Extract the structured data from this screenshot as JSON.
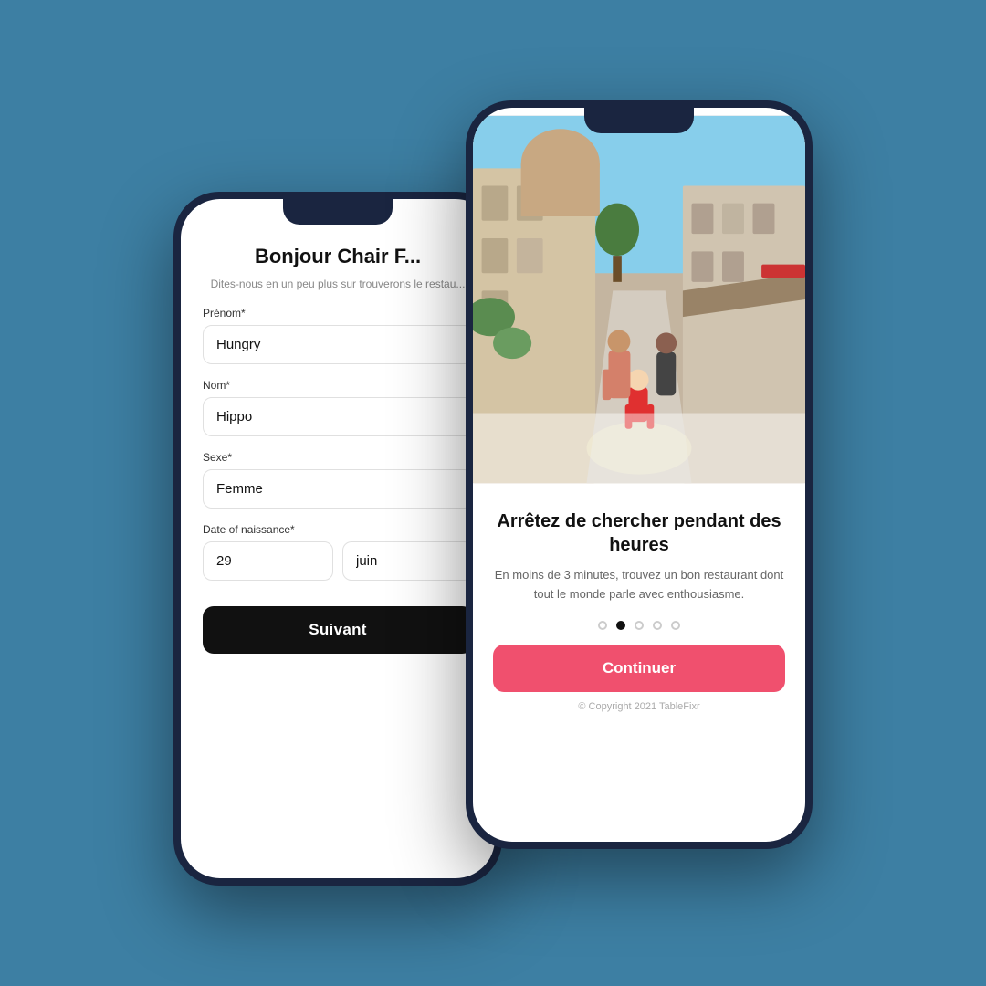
{
  "background_color": "#3d7fa3",
  "phone_back": {
    "title": "Bonjour Chair F...",
    "subtitle": "Dites-nous en un peu plus sur\ntrouverons le restau...",
    "fields": [
      {
        "label": "Prénom*",
        "value": "Hungry",
        "name": "prenom"
      },
      {
        "label": "Nom*",
        "value": "Hippo",
        "name": "nom"
      },
      {
        "label": "Sexe*",
        "value": "Femme",
        "name": "sexe"
      }
    ],
    "dob_label": "Date of naissance*",
    "dob_day": "29",
    "dob_month": "juin",
    "button_label": "Suivant"
  },
  "phone_front": {
    "onboarding_title": "Arrêtez de chercher pendant des heures",
    "onboarding_desc": "En moins de 3 minutes, trouvez un bon restaurant dont tout le monde parle avec enthousiasme.",
    "dots_count": 5,
    "active_dot": 1,
    "button_label": "Continuer",
    "copyright": "© Copyright 2021 TableFixr"
  }
}
